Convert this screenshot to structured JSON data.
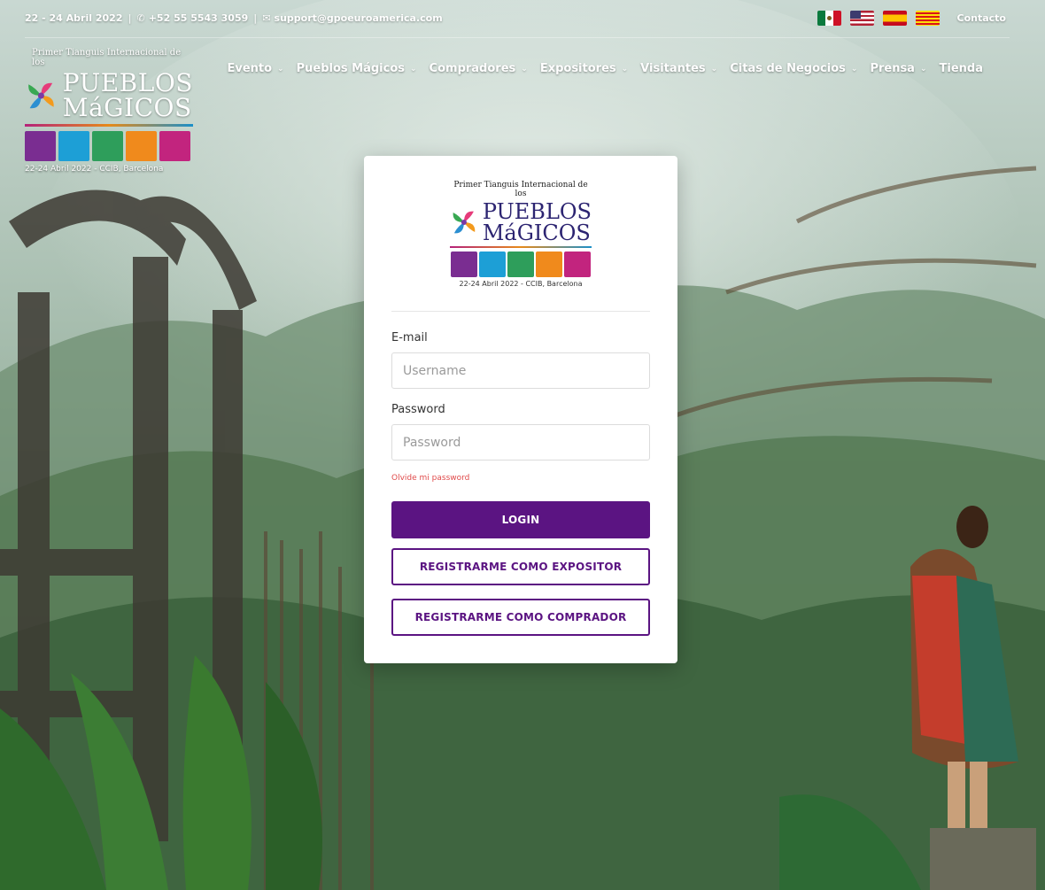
{
  "topbar": {
    "date_partial": "22 - 24 Abril 2022",
    "phone": "+52 55 5543 3059",
    "email": "support@gpoeuroamerica.com",
    "contact_label": "Contacto",
    "flags": [
      "flag-mexico",
      "flag-usa",
      "flag-spain",
      "flag-catalonia"
    ]
  },
  "nav": {
    "items": [
      {
        "label": "Evento"
      },
      {
        "label": "Pueblos Mágicos"
      },
      {
        "label": "Compradores"
      },
      {
        "label": "Expositores"
      },
      {
        "label": "Visitantes"
      },
      {
        "label": "Citas de Negocios"
      },
      {
        "label": "Prensa"
      },
      {
        "label": "Tienda"
      }
    ]
  },
  "brand": {
    "tagline": "Primer Tianguis Internacional de los",
    "name_line1": "PUEBLOS",
    "name_line2": "MáGICOS",
    "date_location": "22-24 Abril 2022 - CCIB, Barcelona",
    "tile_colors": [
      "#7a2d91",
      "#1d9fd6",
      "#2e9e5b",
      "#f08a1c",
      "#c2247e"
    ],
    "swirl_colors": [
      "#e63b7a",
      "#f39a1d",
      "#2b8fd1",
      "#38a852",
      "#7b3aa5"
    ]
  },
  "login": {
    "email_label": "E-mail",
    "email_placeholder": "Username",
    "password_label": "Password",
    "password_placeholder": "Password",
    "forgot_label": "Olvide mi password",
    "login_label": "LOGIN",
    "register_exhibitor_label": "REGISTRARME COMO EXPOSITOR",
    "register_buyer_label": "REGISTRARME COMO COMPRADOR"
  },
  "colors": {
    "primary": "#5b1482",
    "link_error": "#e04a4a"
  }
}
